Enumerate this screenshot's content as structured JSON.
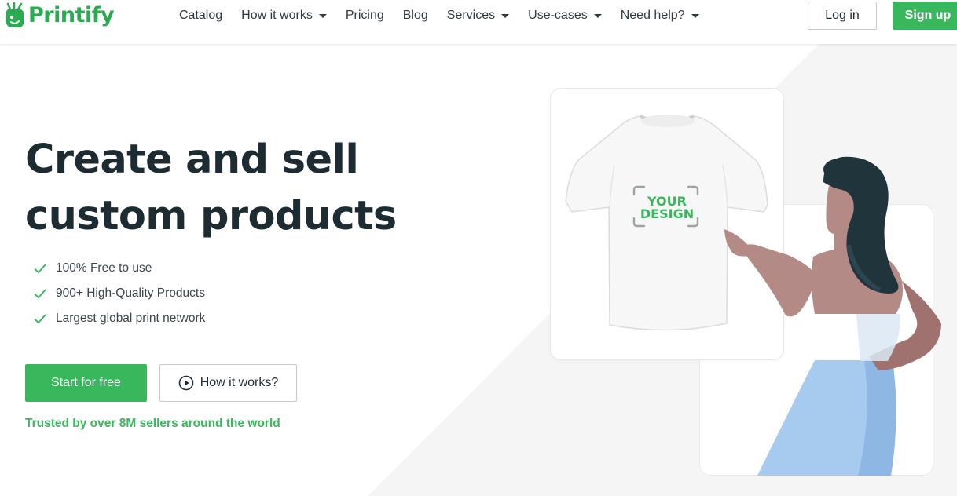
{
  "brand": {
    "name": "Printify",
    "color": "#29ab51"
  },
  "nav": {
    "items": [
      {
        "label": "Catalog",
        "dropdown": false
      },
      {
        "label": "How it works",
        "dropdown": true
      },
      {
        "label": "Pricing",
        "dropdown": false
      },
      {
        "label": "Blog",
        "dropdown": false
      },
      {
        "label": "Services",
        "dropdown": true
      },
      {
        "label": "Use-cases",
        "dropdown": true
      },
      {
        "label": "Need help?",
        "dropdown": true
      }
    ],
    "login_label": "Log in",
    "signup_label": "Sign up"
  },
  "hero": {
    "headline_line1": "Create and sell",
    "headline_line2": "custom products",
    "features": [
      "100% Free to use",
      "900+ High-Quality Products",
      "Largest global print network"
    ],
    "cta_primary": "Start for free",
    "cta_secondary": "How it works?",
    "trusted_text": "Trusted by over 8M sellers around the world"
  },
  "illustration": {
    "design_line1": "YOUR",
    "design_line2": "DESIGN"
  },
  "colors": {
    "accent": "#39b75d",
    "text_dark": "#1d2b32",
    "skin": "#b38a86",
    "hair": "#1f343b",
    "skirt": "#a7cbef"
  }
}
